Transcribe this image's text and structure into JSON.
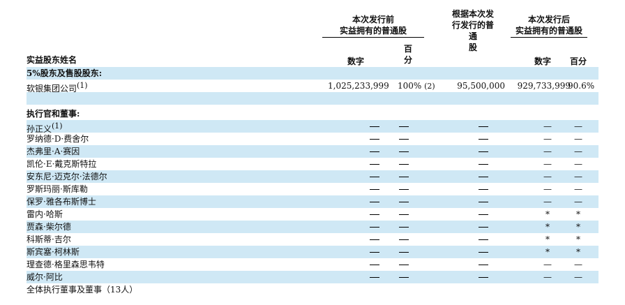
{
  "headers": {
    "pre_group": [
      "本次发行前",
      "实益拥有的普通股"
    ],
    "middle_group": [
      "根据本次发",
      "行发行的普",
      "通",
      "股"
    ],
    "post_group": [
      "本次发行后",
      "实益拥有的普通股"
    ],
    "name_col": "实益股东姓名",
    "pre_number": "数字",
    "pre_percent": [
      "百",
      "分"
    ],
    "post_number": "数字",
    "post_percent": "百分"
  },
  "sections": {
    "major_holders": "5%股东及售股股东:",
    "officers_directors": "执行官和董事:"
  },
  "major_rows": [
    {
      "name": "软银集团公司",
      "note": "(1)",
      "pre_number": "1,025,233,999",
      "pre_percent": "100%",
      "pre_percent_note": "(2)",
      "offered": "95,500,000",
      "post_number": "929,733,999",
      "post_percent": "90.6%"
    }
  ],
  "officer_rows": [
    {
      "name": "孙正义",
      "note": "(1)",
      "post_number": "—",
      "post_percent": "—"
    },
    {
      "name": "罗纳德·D·费舍尔",
      "note": "",
      "post_number": "—",
      "post_percent": "—"
    },
    {
      "name": "杰弗里·A·赛因",
      "note": "",
      "post_number": "—",
      "post_percent": "—"
    },
    {
      "name": "凯伦·E·戴克斯特拉",
      "note": "",
      "post_number": "—",
      "post_percent": "—"
    },
    {
      "name": "安东尼·迈克尔·法德尔",
      "note": "",
      "post_number": "—",
      "post_percent": "—"
    },
    {
      "name": "罗斯玛丽·斯库勒",
      "note": "",
      "post_number": "—",
      "post_percent": "—"
    },
    {
      "name": "保罗·雅各布斯博士",
      "note": "",
      "post_number": "—",
      "post_percent": "—"
    },
    {
      "name": "雷内·哈斯",
      "note": "",
      "post_number": "*",
      "post_percent": "*"
    },
    {
      "name": "贾森·柴尔德",
      "note": "",
      "post_number": "*",
      "post_percent": "*"
    },
    {
      "name": "科斯蒂·吉尔",
      "note": "",
      "post_number": "*",
      "post_percent": "*"
    },
    {
      "name": "斯宾塞·柯林斯",
      "note": "",
      "post_number": "*",
      "post_percent": "*"
    },
    {
      "name": "理查德·格里森思韦特",
      "note": "",
      "post_number": "—",
      "post_percent": "—"
    },
    {
      "name": "威尔·阿比",
      "note": "",
      "post_number": "—",
      "post_percent": "—"
    }
  ],
  "total_row": "全体执行董事及董事（13人）"
}
